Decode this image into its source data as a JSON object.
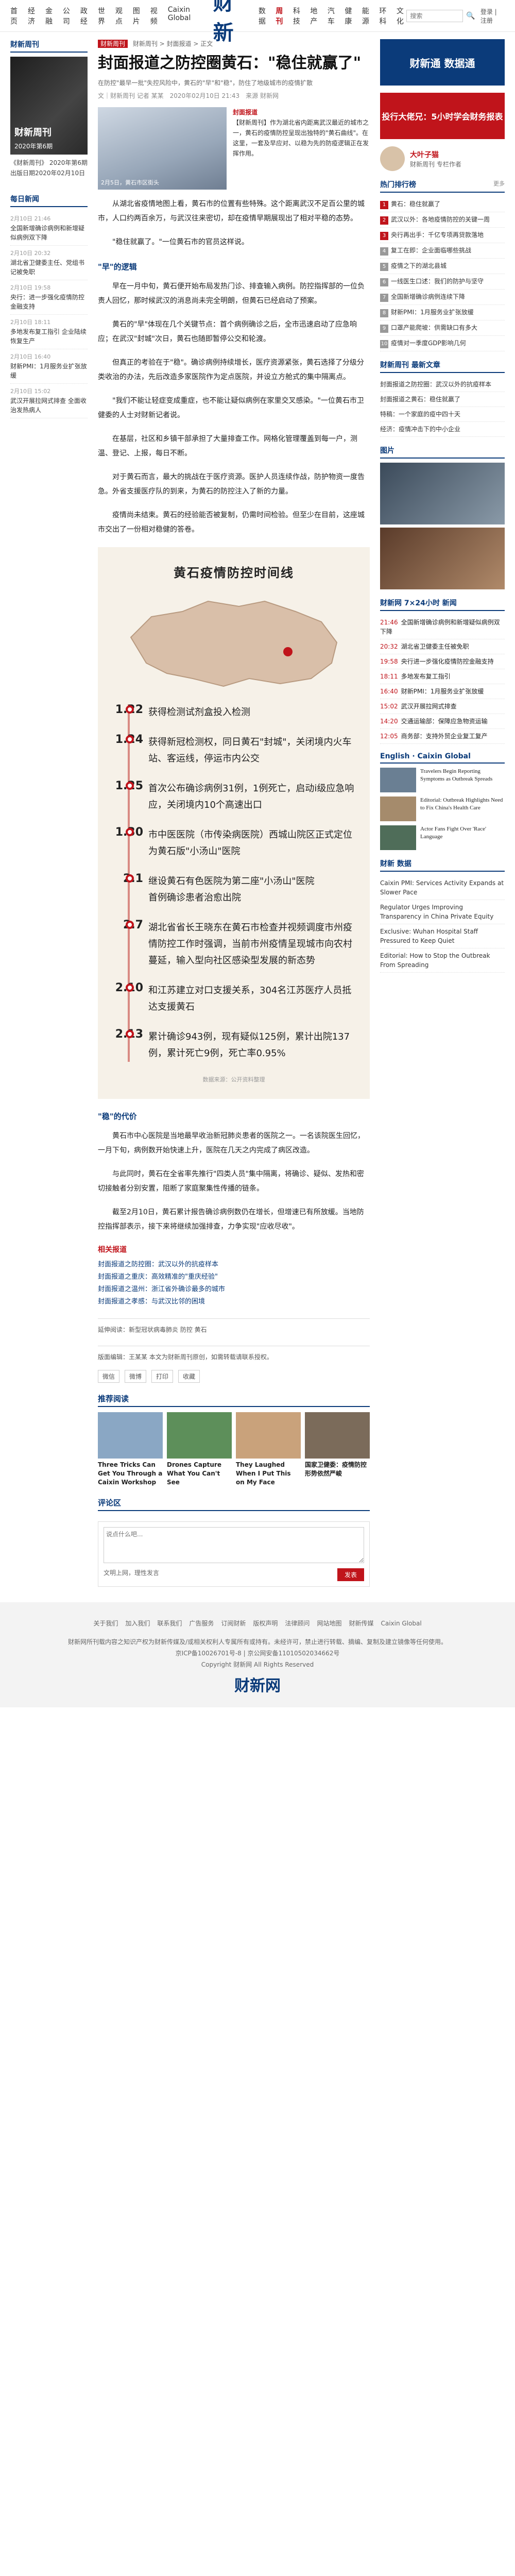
{
  "nav": {
    "left": [
      "首页",
      "经济",
      "金融",
      "公司",
      "政经",
      "世界",
      "观点",
      "图片",
      "视频",
      "Caixin Global"
    ],
    "logo": "财新",
    "right": [
      "数据",
      "周刊",
      "科技",
      "地产",
      "汽车",
      "健康",
      "能源",
      "环科",
      "文化"
    ],
    "active": "周刊",
    "search_placeholder": "搜索",
    "login": "登录 | 注册"
  },
  "left": {
    "mag_title": "财新周刊",
    "cover_name": "财新周刊",
    "cover_caption": "2020年第6期",
    "intro": "《财新周刊》 2020年第6期  出版日期2020年02月10日",
    "latest_title": "每日新闻",
    "latest": [
      {
        "time": "2月10日 21:46",
        "text": "全国新增确诊病例和新增疑似病例双下降"
      },
      {
        "time": "2月10日 20:32",
        "text": "湖北省卫健委主任、党组书记被免职"
      },
      {
        "time": "2月10日 19:58",
        "text": "央行：进一步强化疫情防控金融支持"
      },
      {
        "time": "2月10日 18:11",
        "text": "多地发布复工指引 企业陆续恢复生产"
      },
      {
        "time": "2月10日 16:40",
        "text": "财新PMI：1月服务业扩张放缓"
      },
      {
        "time": "2月10日 15:02",
        "text": "武汉开展拉网式排查 全面收治发热病人"
      }
    ]
  },
  "main": {
    "crumb_badge": "财新周刊",
    "crumb": "财新周刊 > 封面报道 > 正文",
    "title": "封面报道之防控圈黄石：\"稳住就赢了\"",
    "subtitle": "在防控\"最早一批\"失控风险中，黄石的\"早\"和\"稳\"，防住了地级城市的疫情扩散",
    "meta_author": "文｜财新周刊 记者 某某",
    "meta_date": "2020年02月10日 21:43",
    "meta_source": "来源 财新网",
    "lead_cap": "2月5日，黄石市区街头",
    "lead_kicker": "封面报道",
    "lead_text": "【财新周刊】作为湖北省内距离武汉最近的城市之一，黄石的疫情防控呈现出独特的\"黄石曲线\"。在这里，一套及早应对、以稳为先的防疫逻辑正在发挥作用。",
    "paragraphs": [
      "从湖北省疫情地图上看，黄石市的位置有些特殊。这个距离武汉不足百公里的城市，人口约两百余万，与武汉往来密切，却在疫情早期展现出了相对平稳的态势。",
      "\"稳住就赢了。\"一位黄石市的官员这样说。",
      "早在一月中旬，黄石便开始布局发热门诊、排查输入病例。防控指挥部的一位负责人回忆，那时候武汉的消息尚未完全明朗，但黄石已经启动了预案。",
      "黄石的\"早\"体现在几个关键节点：首个病例确诊之后，全市迅速启动了应急响应；在武汉\"封城\"次日，黄石也随即暂停公交和轮渡。",
      "但真正的考验在于\"稳\"。确诊病例持续增长，医疗资源紧张，黄石选择了分级分类收治的办法，先后改造多家医院作为定点医院，并设立方舱式的集中隔离点。",
      "\"我们不能让轻症变成重症，也不能让疑似病例在家里交叉感染。\"一位黄石市卫健委的人士对财新记者说。",
      "在基层，社区和乡镇干部承担了大量排查工作。网格化管理覆盖到每一户，测温、登记、上报，每日不断。",
      "对于黄石而言，最大的挑战在于医疗资源。医护人员连续作战，防护物资一度告急。外省支援医疗队的到来，为黄石的防控注入了新的力量。",
      "疫情尚未结束。黄石的经验能否被复制，仍需时间检验。但至少在目前，这座城市交出了一份相对稳健的答卷。"
    ],
    "sub_heads": [
      "\"早\"的逻辑",
      "\"稳\"的代价"
    ],
    "paragraphs2": [
      "黄石市中心医院是当地最早收治新冠肺炎患者的医院之一。一名该院医生回忆，一月下旬，病例数开始快速上升，医院在几天之内完成了病区改造。",
      "与此同时，黄石在全省率先推行\"四类人员\"集中隔离，将确诊、疑似、发热和密切接触者分别安置，阻断了家庭聚集性传播的链条。",
      "截至2月10日，黄石累计报告确诊病例数仍在增长，但增速已有所放缓。当地防控指挥部表示，接下来将继续加强排查，力争实现\"应收尽收\"。"
    ],
    "timeline": {
      "title": "黄石疫情防控时间线",
      "items": [
        {
          "date": "1.22",
          "text": "获得检测试剂盒投入检测"
        },
        {
          "date": "1.24",
          "text": "获得新冠检测权，同日黄石\"封城\"，关闭境内火车站、客运线，停运市内公交"
        },
        {
          "date": "1.25",
          "text": "首次公布确诊病例31例，1例死亡，启动i级应急响应，关闭境内10个高速出口"
        },
        {
          "date": "1.30",
          "text": "市中医医院（市传染病医院）西城山院区正式定位为黄石版\"小汤山\"医院"
        },
        {
          "date": "2.1",
          "text": "继设黄石有色医院为第二座\"小汤山\"医院\n首例确诊患者治愈出院"
        },
        {
          "date": "2.7",
          "text": "湖北省省长王晓东在黄石市检查并视频调度市州疫情防控工作时强调，当前市州疫情呈现城市向农村蔓延，输入型向社区感染型发展的新态势"
        },
        {
          "date": "2.10",
          "text": "和江苏建立对口支援关系，304名江苏医疗人员抵达支援黄石"
        },
        {
          "date": "2.13",
          "text": "累计确诊943例，现有疑似125例，累计出院137例，累计死亡9例，死亡率0.95%"
        }
      ]
    },
    "timeline_note": "数据来源：公开资料整理",
    "related_title": "相关报道",
    "related": [
      "封面报道之防控圈：武汉以外的抗疫样本",
      "封面报道之重庆：高效精准的\"重庆经验\"",
      "封面报道之温州：浙江省外确诊最多的城市",
      "封面报道之孝感：与武汉比邻的困境"
    ],
    "tags": "延伸阅读：新型冠状病毒肺炎 防控 黄石",
    "bottom_note": "版面编辑：王某某  本文为财新周刊原创，如需转载请联系授权。",
    "share": [
      "微信",
      "微博",
      "打印",
      "收藏"
    ],
    "rec_title": "推荐阅读",
    "rec": [
      {
        "t": "Three Tricks Can Get You Through a Caixin Workshop",
        "c": "#8aa7c4"
      },
      {
        "t": "Drones Capture What You Can't See",
        "c": "#5d8f5a"
      },
      {
        "t": "They Laughed When I Put This on My Face",
        "c": "#c9a27b"
      },
      {
        "t": "国家卫健委：疫情防控形势依然严峻",
        "c": "#7b6b5a"
      }
    ],
    "comment_placeholder": "说点什么吧...",
    "comment_hint": "文明上网，理性发言",
    "comment_btn": "发表",
    "comment_title": "评论区"
  },
  "right": {
    "ad1": "财新通 数据通",
    "ad2": "投行大佬兄：5小时学会财务报表",
    "author_name": "大叶子猫",
    "author_role": "财新周刊 专栏作者",
    "hot_title": "热门排行榜",
    "hot_more": "更多",
    "hot": [
      "黄石：稳住就赢了",
      "武汉以外：各地疫情防控的关键一周",
      "央行再出手：千亿专项再贷款落地",
      "复工在即：企业面临哪些挑战",
      "疫情之下的湖北县城",
      "一线医生口述：我们的防护与坚守",
      "全国新增确诊病例连续下降",
      "财新PMI：1月服务业扩张放缓",
      "口罩产能爬坡：供需缺口有多大",
      "疫情对一季度GDP影响几何"
    ],
    "mag_title": "财新周刊 最新文章",
    "mag_items": [
      "封面报道之防控圈：武汉以外的抗疫样本",
      "封面报道之黄石：稳住就赢了",
      "特稿：一个家庭的疫中四十天",
      "经济：疫情冲击下的中小企业"
    ],
    "photo_title": "图片",
    "tele_title": "财新网 7×24小时 新闻",
    "tele": [
      {
        "t": "21:46",
        "s": "全国新增确诊病例和新增疑似病例双下降"
      },
      {
        "t": "20:32",
        "s": "湖北省卫健委主任被免职"
      },
      {
        "t": "19:58",
        "s": "央行进一步强化疫情防控金融支持"
      },
      {
        "t": "18:11",
        "s": "多地发布复工指引"
      },
      {
        "t": "16:40",
        "s": "财新PMI：1月服务业扩张放缓"
      },
      {
        "t": "15:02",
        "s": "武汉开展拉网式排查"
      },
      {
        "t": "14:20",
        "s": "交通运输部：保障应急物资运输"
      },
      {
        "t": "12:05",
        "s": "商务部：支持外贸企业复工复产"
      }
    ],
    "en_title": "English · Caixin Global",
    "en": [
      {
        "t": "Travelers Begin Reporting Symptoms as Outbreak Spreads",
        "c": "#6a7f93"
      },
      {
        "t": "Editorial: Outbreak Highlights Need to Fix China's Health Care",
        "c": "#a58b6c"
      },
      {
        "t": "Actor Fans Fight Over 'Race' Language",
        "c": "#4f6d59"
      }
    ],
    "bottom_hot_title": "财新 数据",
    "bottom_list": [
      "Caixin PMI: Services Activity Expands at Slower Pace",
      "Regulator Urges Improving Transparency in China Private Equity",
      "Exclusive: Wuhan Hospital Staff Pressured to Keep Quiet",
      "Editorial: How to Stop the Outbreak From Spreading"
    ]
  },
  "footer": {
    "links": [
      "关于我们",
      "加入我们",
      "联系我们",
      "广告服务",
      "订阅财新",
      "版权声明",
      "法律顾问",
      "网站地图",
      "财新传媒",
      "Caixin Global"
    ],
    "logo": "财新网",
    "copy": "财新网所刊载内容之知识产权为财新传媒及/或相关权利人专属所有或持有。未经许可，禁止进行转载、摘编、复制及建立镜像等任何使用。",
    "icp": "京ICP备10026701号-8 | 京公网安备11010502034662号",
    "company": "Copyright 财新网 All Rights Reserved"
  },
  "colors": {
    "brand": "#0b3b7a",
    "accent": "#c0141b",
    "timeline_bg": "#f6f1e8"
  }
}
